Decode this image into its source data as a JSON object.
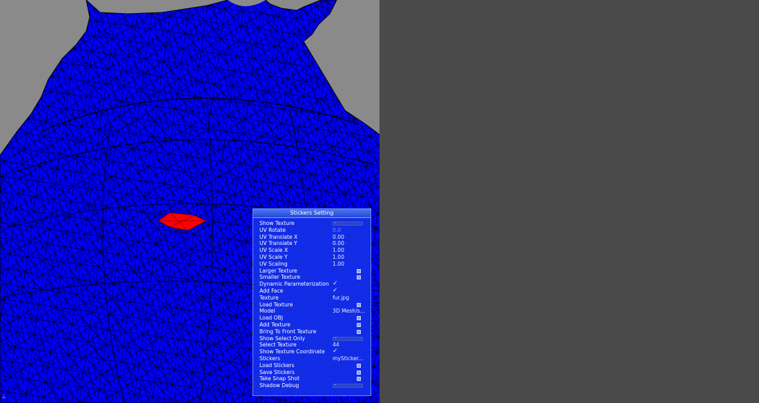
{
  "panel": {
    "title": "Stickers Setting",
    "rows": [
      {
        "label": "Show Texture",
        "kind": "slider",
        "value": "-"
      },
      {
        "label": "UV Rotate",
        "kind": "dimtext",
        "value": "0.0"
      },
      {
        "label": "UV Translate X",
        "kind": "text",
        "value": "0.00"
      },
      {
        "label": "UV Translate Y",
        "kind": "text",
        "value": "0.00"
      },
      {
        "label": "UV Scale X",
        "kind": "text",
        "value": "1.00"
      },
      {
        "label": "UV Scale Y",
        "kind": "text",
        "value": "1.00"
      },
      {
        "label": "UV Scaling",
        "kind": "text",
        "value": "1.00"
      },
      {
        "label": "Larger Texture",
        "kind": "button",
        "value": ""
      },
      {
        "label": "Smaller Texture",
        "kind": "button",
        "value": ""
      },
      {
        "label": "Dynamic Parameterization",
        "kind": "check",
        "value": "✓"
      },
      {
        "label": "Add Face",
        "kind": "check",
        "value": "✓"
      },
      {
        "label": "Texture",
        "kind": "text",
        "value": "fur.jpg"
      },
      {
        "label": "Load Texture",
        "kind": "button",
        "value": ""
      },
      {
        "label": "Model",
        "kind": "trunc",
        "value": "3D Mesh/s..."
      },
      {
        "label": "Load OBJ",
        "kind": "button",
        "value": ""
      },
      {
        "label": "Add Texture",
        "kind": "button",
        "value": ""
      },
      {
        "label": "Bring To Front Texture",
        "kind": "button",
        "value": ""
      },
      {
        "label": "Show Select Only",
        "kind": "slider",
        "value": "-"
      },
      {
        "label": "Select Texture",
        "kind": "text",
        "value": "44"
      },
      {
        "label": "Show Texture Coordinate",
        "kind": "check",
        "value": "✓"
      },
      {
        "label": "Stickers",
        "kind": "trunc",
        "value": "mySticker..."
      },
      {
        "label": "Load Stickers",
        "kind": "button",
        "value": ""
      },
      {
        "label": "Save Stickers",
        "kind": "button",
        "value": ""
      },
      {
        "label": "Take Snap Shot",
        "kind": "button",
        "value": ""
      },
      {
        "label": "Shadow Debug",
        "kind": "slider",
        "value": "-"
      }
    ]
  },
  "colors": {
    "mesh_fill": "#0000ff",
    "mesh_lines": "#000000",
    "selected_face": "#ff0000",
    "viewport_bg": "#8a8a8a",
    "side_bg": "#4a4a4a"
  },
  "corner_mark": "⊥"
}
